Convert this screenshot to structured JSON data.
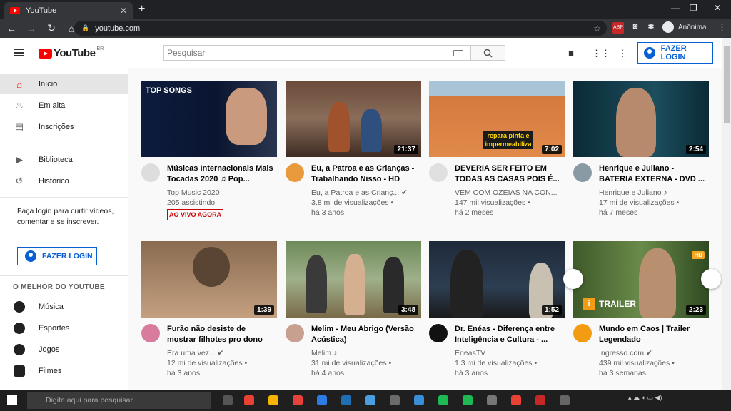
{
  "browser": {
    "tab_title": "YouTube",
    "url": "youtube.com",
    "profile_label": "Anônima"
  },
  "header": {
    "brand": "YouTube",
    "region": "BR",
    "search_placeholder": "Pesquisar",
    "login_label": "FAZER LOGIN"
  },
  "sidebar": {
    "primary": [
      {
        "label": "Início",
        "icon": "home-icon"
      },
      {
        "label": "Em alta",
        "icon": "fire-icon"
      },
      {
        "label": "Inscrições",
        "icon": "subscriptions-icon"
      }
    ],
    "secondary": [
      {
        "label": "Biblioteca",
        "icon": "library-icon"
      },
      {
        "label": "Histórico",
        "icon": "history-icon"
      }
    ],
    "login_prompt": "Faça login para curtir vídeos, comentar e se inscrever.",
    "login_label": "FAZER LOGIN",
    "section_title": "O MELHOR DO YOUTUBE",
    "categories": [
      {
        "label": "Música",
        "icon": "music-icon"
      },
      {
        "label": "Esportes",
        "icon": "sports-icon"
      },
      {
        "label": "Jogos",
        "icon": "games-icon"
      },
      {
        "label": "Filmes",
        "icon": "movies-icon"
      }
    ]
  },
  "videos": [
    {
      "title": "Músicas Internacionais Mais Tocadas 2020 ♫ Pop...",
      "channel": "Top Music 2020",
      "meta2": "205 assistindo",
      "badge": "AO VIVO AGORA",
      "duration": "",
      "thumb_text": "TOP SONGS"
    },
    {
      "title": "Eu, a Patroa e as Crianças - Trabalhando Nisso - HD",
      "channel": "Eu, a Patroa e as Crianç... ✔",
      "meta2": "3,8 mi de visualizações •",
      "meta3": "há 3 anos",
      "duration": "21:37"
    },
    {
      "title": "DEVERIA SER FEITO EM TODAS AS CASAS POIS É...",
      "channel": "VEM COM OZEIAS NA CON...",
      "meta2": "147 mil visualizações •",
      "meta3": "há 2 meses",
      "duration": "7:02",
      "thumb_text": "repara pinta e impermeabiliza"
    },
    {
      "title": "Henrique e Juliano - BATERIA EXTERNA - DVD ...",
      "channel": "Henrique e Juliano ♪",
      "meta2": "17 mi de visualizações •",
      "meta3": "há 7 meses",
      "duration": "2:54"
    },
    {
      "title": "Furão não desiste de mostrar filhotes pro dono",
      "channel": "Era uma vez... ✔",
      "meta2": "12 mi de visualizações •",
      "meta3": "há 3 anos",
      "duration": "1:39"
    },
    {
      "title": "Melim - Meu Abrigo (Versão Acústica)",
      "channel": "Melim ♪",
      "meta2": "31 mi de visualizações •",
      "meta3": "há 4 anos",
      "duration": "3:48"
    },
    {
      "title": "Dr. Enéas - Diferença entre Inteligência e Cultura - ...",
      "channel": "EneasTV",
      "meta2": "1,3 mi de visualizações •",
      "meta3": "há 3 anos",
      "duration": "1:52"
    },
    {
      "title": "Mundo em Caos | Trailer Legendado",
      "channel": "Ingresso.com ✔",
      "meta2": "439 mil visualizações •",
      "meta3": "há 3 semanas",
      "duration": "2:23",
      "thumb_text": "TRAILER",
      "hd": "HD"
    }
  ],
  "taskbar": {
    "search_placeholder": "Digite aqui para pesquisar"
  }
}
